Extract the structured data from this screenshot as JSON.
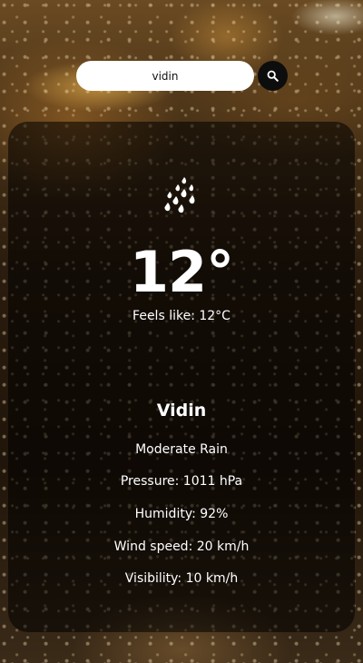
{
  "search": {
    "value": "vidin"
  },
  "weather": {
    "icon": "rain-icon",
    "temperature": "12°",
    "feels_like": "Feels like: 12°C",
    "city": "Vidin",
    "description": "Moderate Rain",
    "pressure": "Pressure: 1011 hPa",
    "humidity": "Humidity: 92%",
    "wind_speed": "Wind speed: 20 km/h",
    "visibility": "Visibility: 10 km/h"
  },
  "colors": {
    "card_background": "#000000",
    "text": "#ffffff",
    "search_button": "#0d0d0d"
  }
}
